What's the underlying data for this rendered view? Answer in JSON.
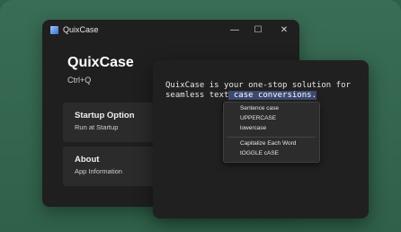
{
  "app": {
    "window_title": "QuixCase",
    "heading": "QuixCase",
    "shortcut": "Ctrl+Q"
  },
  "window_controls": {
    "minimize": "—",
    "maximize": "☐",
    "close": "✕"
  },
  "cards": [
    {
      "title": "Startup Option",
      "subtitle": "Run at Startup"
    },
    {
      "title": "About",
      "subtitle": "App Information"
    }
  ],
  "editor": {
    "line1": "QuixCase is your one-stop solution for",
    "line2_plain": "seamless text",
    "line2_selected": " case conversions."
  },
  "context_menu": {
    "items": [
      "Sentence case",
      "UPPERCASE",
      "lowercase",
      "Capitalize Each Word",
      "tOGGLE cASE"
    ]
  },
  "colors": {
    "background": "#2f6049",
    "window": "#1f1f1f",
    "card": "#2b2b2b",
    "selection": "#3c4a72"
  }
}
